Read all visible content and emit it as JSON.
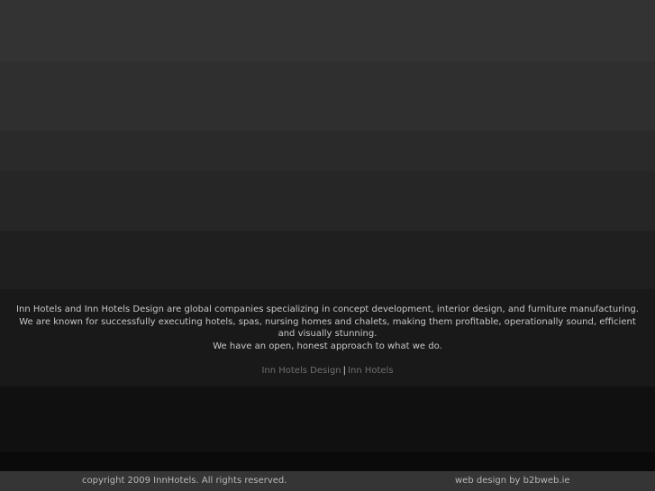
{
  "intro": {
    "line1": "Inn Hotels and Inn Hotels Design are global companies specializing in concept development, interior design, and furniture manufacturing.",
    "line2": "We are known for successfully executing hotels, spas, nursing homes and chalets, making them profitable, operationally sound, efficient",
    "line3": "and visually stunning.",
    "line4": "We have an open, honest approach to what we do."
  },
  "links": {
    "design_label": "Inn Hotels Design",
    "separator": "|",
    "hotels_label": "Inn Hotels"
  },
  "footer": {
    "copyright": "copyright 2009 InnHotels. All rights reserved.",
    "credit": "web design by b2bweb.ie"
  },
  "colors": {
    "background_top": "#333333",
    "background_bottom": "#0a0a0a",
    "footer_bar": "#353535",
    "text": "#c8c8c8",
    "link": "#6f6f6f"
  }
}
